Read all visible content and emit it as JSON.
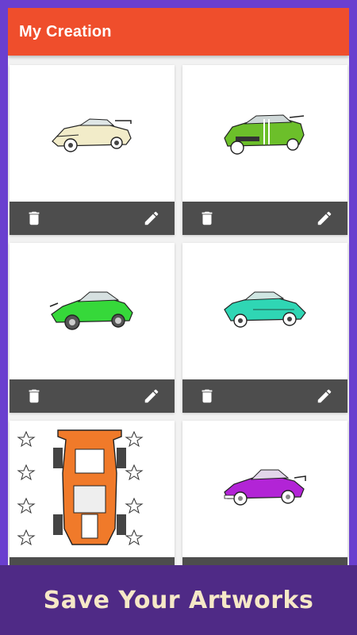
{
  "app": {
    "title": "My Creation",
    "accent": "#ef4e2c",
    "frame_color": "#6a3fcf"
  },
  "artworks": [
    {
      "name": "white-supercar-drawing",
      "color": "#f2ecc9"
    },
    {
      "name": "green-muscle-car-drawing",
      "color": "#6cbf2a"
    },
    {
      "name": "green-porsche-drawing",
      "color": "#36d83a"
    },
    {
      "name": "teal-supra-drawing",
      "color": "#2fd6b4"
    },
    {
      "name": "orange-racecar-topview-drawing",
      "color": "#f07a2a"
    },
    {
      "name": "purple-porsche-drawing",
      "color": "#b224d6"
    }
  ],
  "card_actions": {
    "delete_icon": "trash-icon",
    "edit_icon": "pencil-icon",
    "bar_color": "#4d4d4d"
  },
  "footer": {
    "caption": "Save Your Artworks",
    "background": "#4f2a86",
    "text_color": "#f6e8c7"
  }
}
